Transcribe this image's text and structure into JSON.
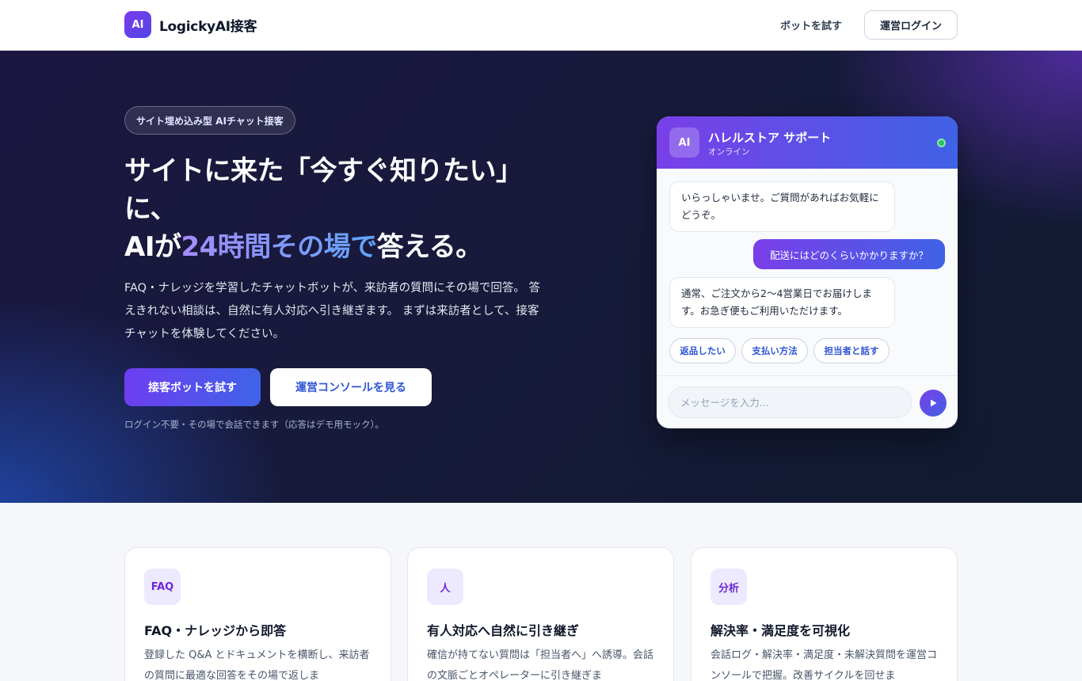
{
  "header": {
    "logo_text": "AI",
    "brand": "LogickyAI接客",
    "nav_try": "ボットを試す",
    "nav_login": "運営ログイン"
  },
  "hero": {
    "pill": "サイト埋め込み型 AIチャット接客",
    "headline_line1": "サイトに来た「今すぐ知りたい」",
    "headline_line2": "に、",
    "headline_pre": "AIが",
    "headline_accent": "24時間その場で",
    "headline_post": "答える。",
    "lead": "FAQ・ナレッジを学習したチャットボットが、来訪者の質問にその場で回答。 答えきれない相談は、自然に有人対応へ引き継ぎます。 まずは来訪者として、接客チャットを体験してください。",
    "cta_primary": "接客ボットを試す",
    "cta_secondary": "運営コンソールを見る",
    "note": "ログイン不要・その場で会話できます（応答はデモ用モック）。"
  },
  "chat": {
    "avatar": "AI",
    "title": "ハレルストア サポート",
    "status": "オンライン",
    "messages": [
      {
        "role": "bot",
        "text": "いらっしゃいませ。ご質問があればお気軽にどうぞ。"
      },
      {
        "role": "user",
        "text": "配送にはどのくらいかかりますか？"
      },
      {
        "role": "bot",
        "text": "通常、ご注文から2〜4営業日でお届けします。お急ぎ便もご利用いただけます。"
      }
    ],
    "quick_replies": [
      "返品したい",
      "支払い方法",
      "担当者と話す"
    ],
    "input_placeholder": "メッセージを入力...",
    "online_color": "#22c55e"
  },
  "features": [
    {
      "icon": "FAQ",
      "title": "FAQ・ナレッジから即答",
      "body": "登録した Q&A とドキュメントを横断し、来訪者の質問に最適な回答をその場で返しま"
    },
    {
      "icon": "人",
      "title": "有人対応へ自然に引き継ぎ",
      "body": "確信が持てない質問は「担当者へ」へ誘導。会話の文脈ごとオペレーターに引き継ぎま"
    },
    {
      "icon": "分析",
      "title": "解決率・満足度を可視化",
      "body": "会話ログ・解決率・満足度・未解決質問を運営コンソールで把握。改善サイクルを回せま"
    }
  ],
  "colors": {
    "accent": "#6d3ef0",
    "accent_blue": "#3f63e8",
    "hero_bg": "#171a3a"
  }
}
